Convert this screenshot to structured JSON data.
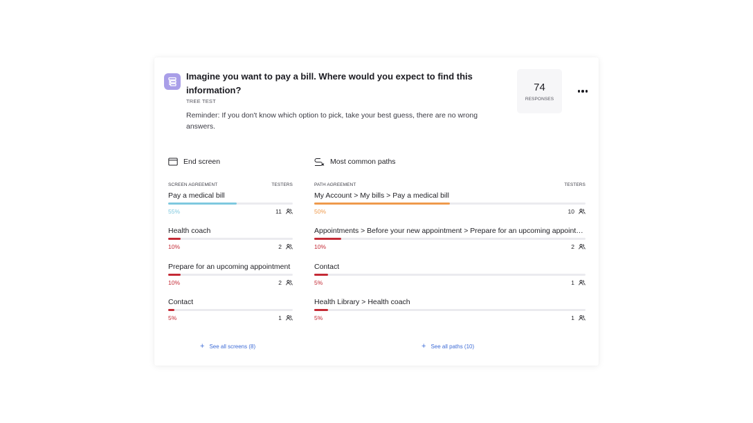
{
  "question": {
    "title": "Imagine you want to pay a bill. Where would you expect to find this information?",
    "type": "TREE TEST",
    "description": "Reminder: If you don't know which option to pick, take your best guess, there are no wrong answers.",
    "icon": "tree-test-icon",
    "icon_color": "#a99ee8"
  },
  "responses": {
    "count": "74",
    "label": "RESPONSES"
  },
  "end_screen": {
    "title": "End screen",
    "col_left": "SCREEN AGREEMENT",
    "col_right": "TESTERS",
    "items": [
      {
        "label": "Pay a medical bill",
        "percent_text": "55%",
        "fraction": 0.55,
        "testers": "11",
        "color": "#7ec8df"
      },
      {
        "label": "Health coach",
        "percent_text": "10%",
        "fraction": 0.1,
        "testers": "2",
        "color": "#c42a35"
      },
      {
        "label": "Prepare for an upcoming appointment",
        "percent_text": "10%",
        "fraction": 0.1,
        "testers": "2",
        "color": "#c42a35"
      },
      {
        "label": "Contact",
        "percent_text": "5%",
        "fraction": 0.05,
        "testers": "1",
        "color": "#c42a35"
      }
    ],
    "see_all": "See all screens (8)"
  },
  "common_paths": {
    "title": "Most common paths",
    "col_left": "PATH AGREEMENT",
    "col_right": "TESTERS",
    "items": [
      {
        "label": "My Account > My bills > Pay a medical bill",
        "percent_text": "50%",
        "fraction": 0.5,
        "testers": "10",
        "color": "#ef9a4c"
      },
      {
        "label": "Appointments > Before your new appointment > Prepare for an upcoming appointment",
        "percent_text": "10%",
        "fraction": 0.1,
        "testers": "2",
        "color": "#c42a35"
      },
      {
        "label": "Contact",
        "percent_text": "5%",
        "fraction": 0.05,
        "testers": "1",
        "color": "#c42a35"
      },
      {
        "label": "Health Library > Health coach",
        "percent_text": "5%",
        "fraction": 0.05,
        "testers": "1",
        "color": "#c42a35"
      }
    ],
    "see_all": "See all paths (10)"
  },
  "colors": {
    "link": "#3d6bd6",
    "accent_purple": "#a99ee8"
  }
}
